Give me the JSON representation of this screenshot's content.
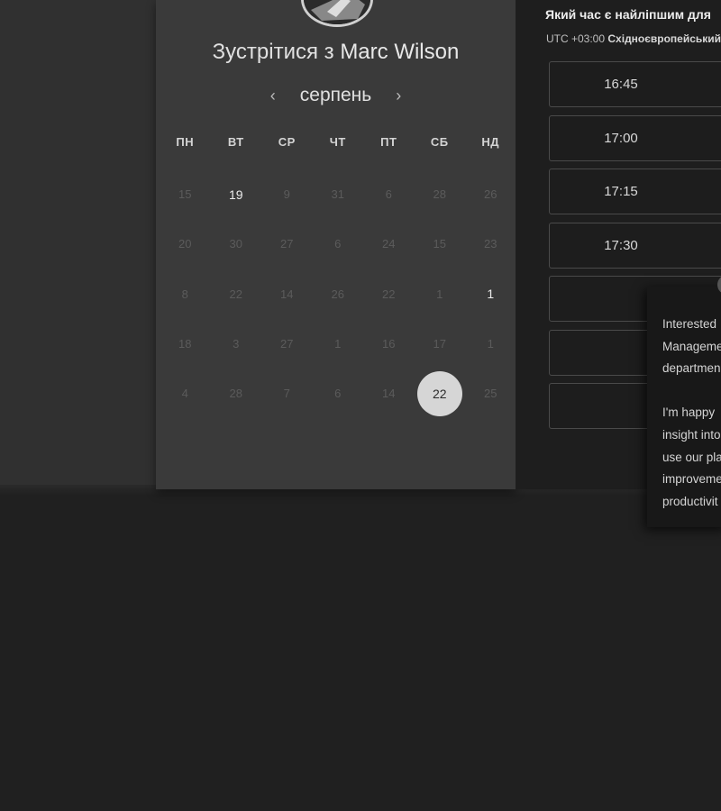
{
  "meeting": {
    "title_prefix": "Зустрітися з",
    "host_name": "Marc Wilson"
  },
  "calendar": {
    "month": "серпень",
    "prev_icon": "‹",
    "next_icon": "›",
    "weekdays": [
      "ПН",
      "ВТ",
      "СР",
      "ЧТ",
      "ПТ",
      "СБ",
      "НД"
    ],
    "weeks": [
      [
        {
          "d": "15"
        },
        {
          "d": "19",
          "avail": true
        },
        {
          "d": "9"
        },
        {
          "d": "31"
        },
        {
          "d": "6"
        },
        {
          "d": "28"
        },
        {
          "d": "26"
        }
      ],
      [
        {
          "d": "20"
        },
        {
          "d": "30"
        },
        {
          "d": "27"
        },
        {
          "d": "6"
        },
        {
          "d": "24"
        },
        {
          "d": "15"
        },
        {
          "d": "23"
        }
      ],
      [
        {
          "d": "8"
        },
        {
          "d": "22"
        },
        {
          "d": "14"
        },
        {
          "d": "26"
        },
        {
          "d": "22"
        },
        {
          "d": "1"
        },
        {
          "d": "1",
          "avail": true
        }
      ],
      [
        {
          "d": "18"
        },
        {
          "d": "3"
        },
        {
          "d": "27"
        },
        {
          "d": "1"
        },
        {
          "d": "16"
        },
        {
          "d": "17"
        },
        {
          "d": "1"
        }
      ],
      [
        {
          "d": "4"
        },
        {
          "d": "28"
        },
        {
          "d": "7"
        },
        {
          "d": "6"
        },
        {
          "d": "14"
        },
        {
          "d": "22",
          "selected": true
        },
        {
          "d": "25"
        }
      ]
    ]
  },
  "times": {
    "question": "Який час є найліпшим для",
    "tz_offset": "UTC +03:00",
    "tz_name": "Східноєвропейський",
    "slots": [
      "16:45",
      "17:00",
      "17:15",
      "17:30",
      "",
      "",
      ""
    ]
  },
  "popup": {
    "lines": [
      "Interested",
      "Manageme",
      "departmen",
      "",
      "I'm happy",
      "insight into",
      "use our pla",
      "improveme",
      "productivit"
    ]
  },
  "colors": {
    "page_bg": "#202020",
    "card_bg": "#3a3a3a",
    "selected_day": "#d6d6d6"
  }
}
